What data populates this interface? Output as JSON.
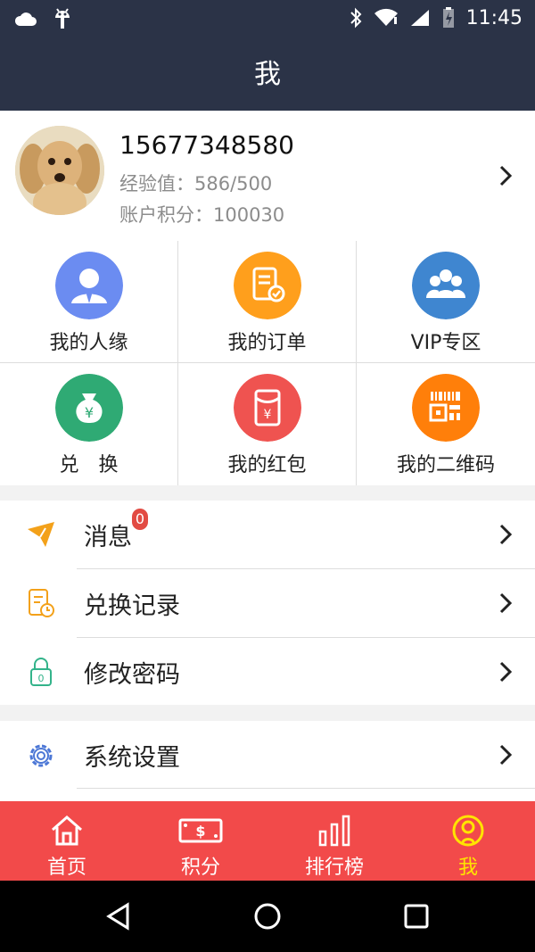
{
  "status_bar": {
    "time": "11:45"
  },
  "title": "我",
  "profile": {
    "phone": "15677348580",
    "exp_label": "经验值：",
    "exp_value": "586/500",
    "points_label": "账户积分：",
    "points_value": "100030"
  },
  "grid": [
    {
      "label": "我的人缘",
      "icon": "user-icon",
      "color": "#6b8cf1"
    },
    {
      "label": "我的订单",
      "icon": "order-icon",
      "color": "#ff9f1c"
    },
    {
      "label": "VIP专区",
      "icon": "vip-group-icon",
      "color": "#3f86d0"
    },
    {
      "label": "兑　换",
      "icon": "money-bag-icon",
      "color": "#2faa74"
    },
    {
      "label": "我的红包",
      "icon": "red-envelope-icon",
      "color": "#ef5350"
    },
    {
      "label": "我的二维码",
      "icon": "qr-code-icon",
      "color": "#ff7f0a"
    }
  ],
  "menu": {
    "messages_label": "消息",
    "messages_badge": "0",
    "exchange_label": "兑换记录",
    "password_label": "修改密码",
    "settings_label": "系统设置"
  },
  "tabs": [
    {
      "label": "首页",
      "icon": "home-icon"
    },
    {
      "label": "积分",
      "icon": "points-icon"
    },
    {
      "label": "排行榜",
      "icon": "ranking-icon"
    },
    {
      "label": "我",
      "icon": "profile-tab-icon",
      "active": true
    }
  ],
  "colors": {
    "header": "#2b3347",
    "tabbar": "#f24a4a",
    "active_tab": "#ffe400",
    "badge": "#e24b43",
    "menu_icon_orange": "#f3a11a",
    "menu_icon_green": "#33b38a",
    "menu_icon_blue": "#4d78d6"
  }
}
